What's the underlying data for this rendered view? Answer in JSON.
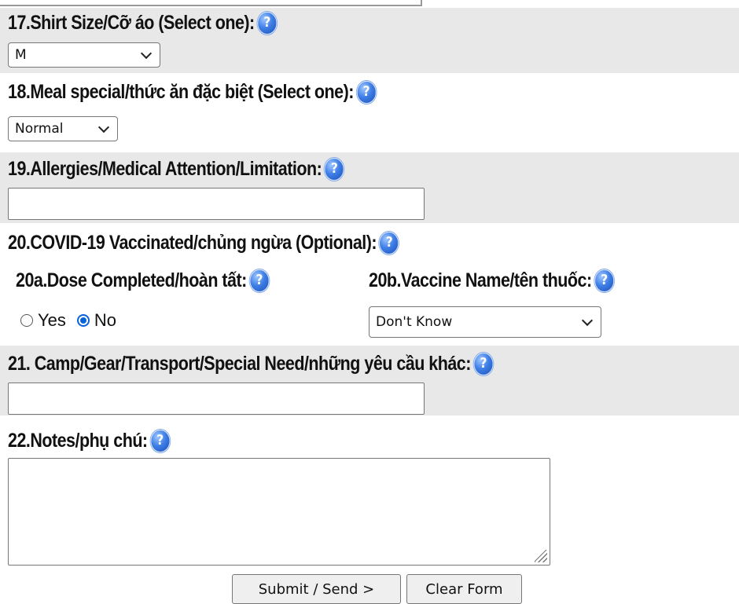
{
  "q17": {
    "label": "17.Shirt Size/Cỡ áo (Select one):",
    "help": "?",
    "value": "M"
  },
  "q18": {
    "label": "18.Meal special/thức ăn đặc biệt (Select one):",
    "help": "?",
    "value": "Normal"
  },
  "q19": {
    "label": "19.Allergies/Medical Attention/Limitation:",
    "help": "?",
    "value": ""
  },
  "q20": {
    "label": "20.COVID-19 Vaccinated/chủng ngừa (Optional):",
    "help": "?"
  },
  "q20a": {
    "label": "20a.Dose Completed/hoàn tất:",
    "help": "?",
    "options": [
      "Yes",
      "No"
    ],
    "selected": "No"
  },
  "q20b": {
    "label": "20b.Vaccine Name/tên thuốc:",
    "help": "?",
    "value": "Don't Know"
  },
  "q21": {
    "label": "21. Camp/Gear/Transport/Special Need/những yêu cầu khác:",
    "help": "?",
    "value": ""
  },
  "q22": {
    "label": "22.Notes/phụ chú:",
    "help": "?",
    "value": ""
  },
  "actions": {
    "submit": "Submit / Send >",
    "clear": "Clear Form"
  },
  "icons": {
    "help": "help-question-icon",
    "dropdown": "chevron-down-icon",
    "resize": "resize-grip-icon"
  },
  "colors": {
    "band": "#e8e8e8",
    "help_icon": "#3f7fe6",
    "radio_selected": "#0a63d6"
  }
}
